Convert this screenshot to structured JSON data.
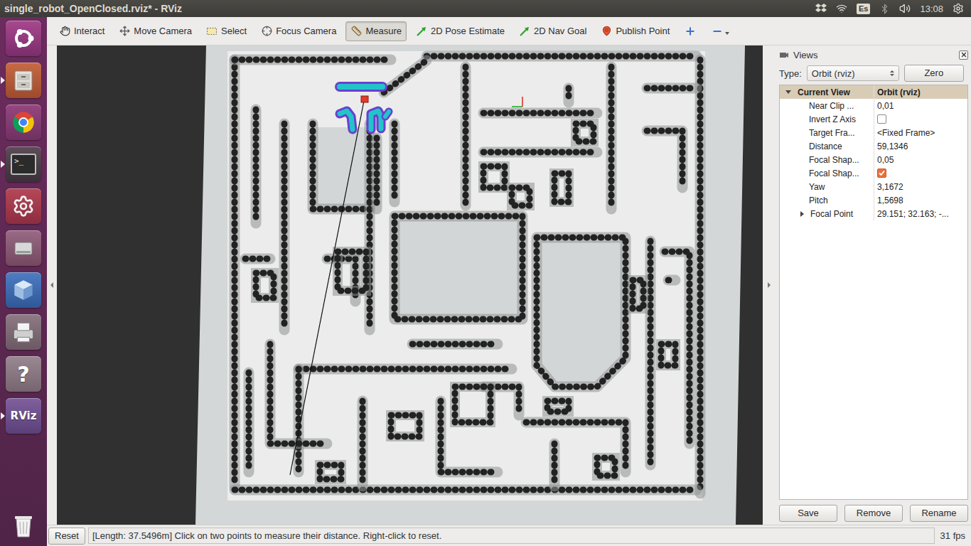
{
  "window": {
    "title": "single_robot_OpenClosed.rviz* - RViz"
  },
  "top_bar": {
    "keyboard": "Es",
    "clock": "13:08"
  },
  "launcher": [
    {
      "kind": "ubuntu",
      "running": false
    },
    {
      "kind": "files",
      "running": true
    },
    {
      "kind": "chrome",
      "running": false
    },
    {
      "kind": "terminal",
      "running": true,
      "text": ">_"
    },
    {
      "kind": "settings",
      "running": false
    },
    {
      "kind": "disk",
      "running": false
    },
    {
      "kind": "box",
      "running": false
    },
    {
      "kind": "scanner",
      "running": false
    },
    {
      "kind": "help",
      "running": false,
      "text": "?"
    },
    {
      "kind": "rviz",
      "running": true,
      "text": "RViz"
    },
    {
      "kind": "trash",
      "running": false
    }
  ],
  "toolbar": {
    "tools": [
      {
        "kind": "interact",
        "label": "Interact",
        "selected": false
      },
      {
        "kind": "move",
        "label": "Move Camera",
        "selected": false
      },
      {
        "kind": "select",
        "label": "Select",
        "selected": false
      },
      {
        "kind": "focus",
        "label": "Focus Camera",
        "selected": false
      },
      {
        "kind": "measure",
        "label": "Measure",
        "selected": true
      },
      {
        "kind": "pose",
        "label": "2D Pose Estimate",
        "selected": false
      },
      {
        "kind": "goal",
        "label": "2D Nav Goal",
        "selected": false
      },
      {
        "kind": "point",
        "label": "Publish Point",
        "selected": false
      }
    ]
  },
  "views_panel": {
    "title": "Views",
    "type_label": "Type:",
    "type_value": "Orbit (rviz)",
    "zero_button": "Zero",
    "columns": [
      "Current View",
      "Orbit (rviz)"
    ],
    "expanded": true,
    "rows": [
      {
        "label": "Near Clip ...",
        "kind": "text",
        "value": "0,01"
      },
      {
        "label": "Invert Z Axis",
        "kind": "checkbox",
        "checked": false
      },
      {
        "label": "Target Fra...",
        "kind": "text",
        "value": "<Fixed Frame>"
      },
      {
        "label": "Distance",
        "kind": "text",
        "value": "59,1346"
      },
      {
        "label": "Focal Shap...",
        "kind": "text",
        "value": "0,05"
      },
      {
        "label": "Focal Shap...",
        "kind": "checkbox",
        "checked": true
      },
      {
        "label": "Yaw",
        "kind": "text",
        "value": "3,1672"
      },
      {
        "label": "Pitch",
        "kind": "text",
        "value": "1,5698"
      },
      {
        "label": "Focal Point",
        "kind": "group",
        "value": "29.151; 32.163; -...",
        "expanded": false
      }
    ],
    "buttons": [
      "Save",
      "Remove",
      "Rename"
    ]
  },
  "status_bar": {
    "reset_button": "Reset",
    "message": "[Length: 37.5496m] Click on two points to measure their distance. Right-click to reset.",
    "fps": "31 fps"
  }
}
